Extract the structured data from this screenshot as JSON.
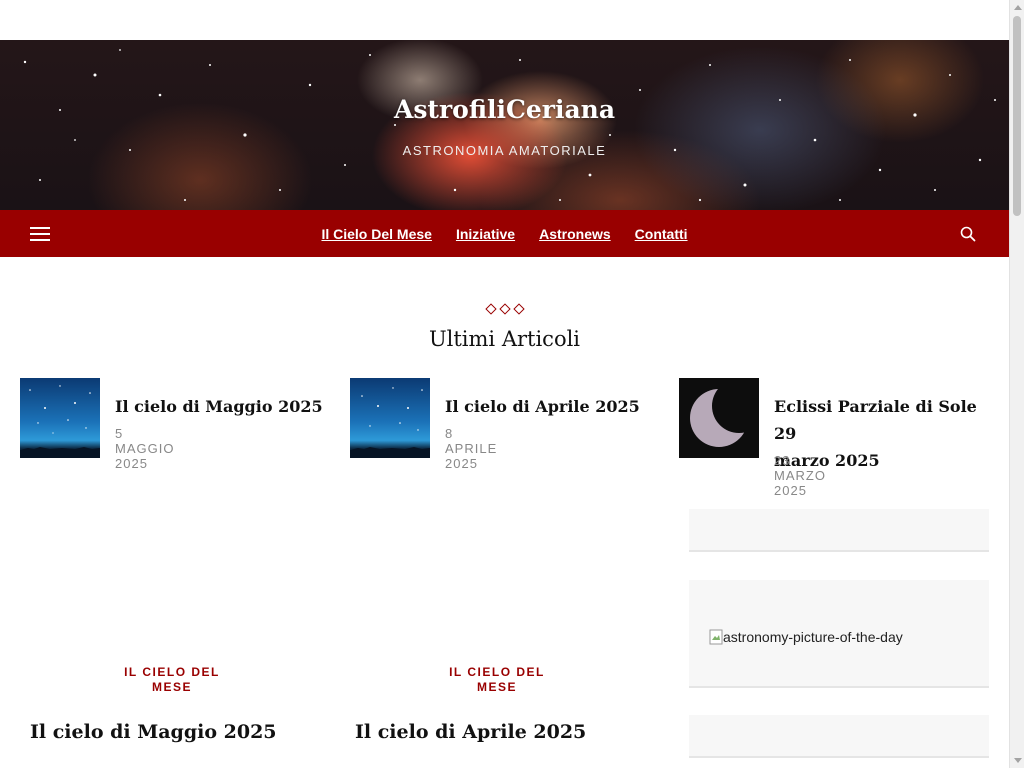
{
  "header": {
    "site_title": "AstrofiliCeriana",
    "tagline": "ASTRONOMIA AMATORIALE"
  },
  "nav": {
    "items": [
      {
        "label": "Il Cielo Del Mese"
      },
      {
        "label": "Iniziative"
      },
      {
        "label": "Astronews"
      },
      {
        "label": "Contatti"
      }
    ]
  },
  "section": {
    "title": "Ultimi Articoli"
  },
  "recent_posts": [
    {
      "title": "Il cielo di Maggio 2025",
      "date": "5 MAGGIO 2025"
    },
    {
      "title": "Il cielo di Aprile 2025",
      "date": "8 APRILE 2025"
    },
    {
      "title_line1": "Eclissi Parziale di Sole 29",
      "title_line2": "marzo 2025",
      "date": "23 MARZO 2025"
    }
  ],
  "sidebar": {
    "apod_alt": "astronomy-picture-of-the-day"
  },
  "posts": [
    {
      "category_line1": "IL CIELO DEL",
      "category_line2": "MESE",
      "title": "Il cielo di Maggio 2025"
    },
    {
      "category_line1": "IL CIELO DEL",
      "category_line2": "MESE",
      "title": "Il cielo di Aprile 2025"
    }
  ],
  "colors": {
    "brand_red": "#990000",
    "text_dark": "#111111",
    "date_gray": "#888888"
  },
  "icons": {
    "menu": "hamburger-icon",
    "search": "search-icon",
    "broken_image": "broken-image-icon"
  }
}
